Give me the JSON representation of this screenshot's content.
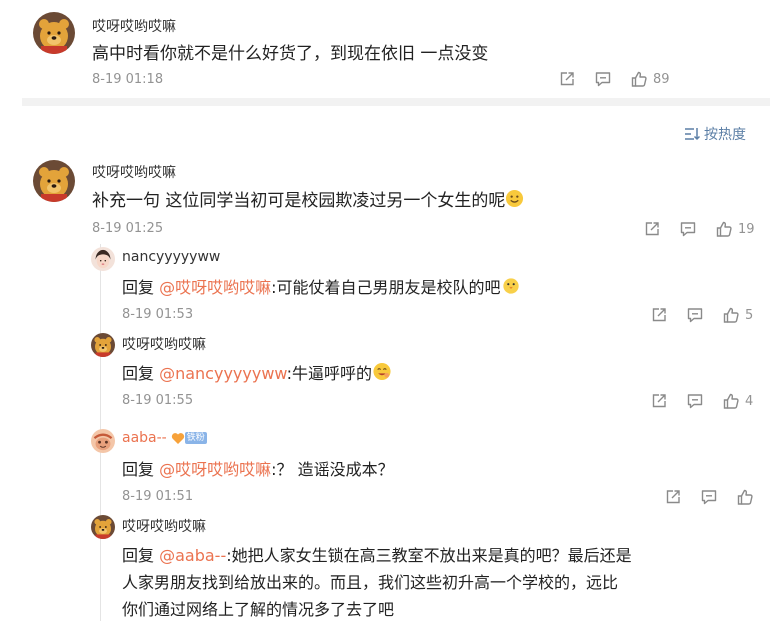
{
  "comments": [
    {
      "user": "哎呀哎哟哎嘛",
      "text": "高中时看你就不是什么好货了，到现在依旧 一点没变",
      "time": "8-19 01:18",
      "likes": "89"
    },
    {
      "user": "哎呀哎哟哎嘛",
      "text": "补充一句 这位同学当初可是校园欺凌过另一个女生的呢",
      "time": "8-19 01:25",
      "likes": "19",
      "replies": [
        {
          "user": "nancyyyyyww",
          "prefix": "回复 ",
          "mention": "@哎呀哎哟哎嘛",
          "text": ":可能仗着自己男朋友是校队的吧",
          "time": "8-19 01:53",
          "likes": "5"
        },
        {
          "user": "哎呀哎哟哎嘛",
          "prefix": "回复 ",
          "mention": "@nancyyyyyww",
          "text": ":牛逼呼呼的",
          "time": "8-19 01:55",
          "likes": "4"
        },
        {
          "user": "aaba--",
          "badge": "铁粉",
          "prefix": "回复 ",
          "mention": "@哎呀哎哟哎嘛",
          "text": ":？ 造谣没成本？",
          "time": "8-19 01:51",
          "likes": ""
        },
        {
          "user": "哎呀哎哟哎嘛",
          "prefix": "回复 ",
          "mention": "@aaba--",
          "text_lines": [
            ":她把人家女生锁在高三教室不放出来是真的吧？最后还是",
            "人家男朋友找到给放出来的。而且，我们这些初升高一个学校的，远比",
            "你们通过网络上了解的情况多了去了吧"
          ]
        }
      ]
    }
  ],
  "sort_label": "按热度",
  "icons": {
    "share": "share-icon",
    "comment": "comment-icon",
    "like": "like-icon",
    "sort": "sort-icon"
  },
  "colors": {
    "mention": "#eb7350",
    "sort": "#5c7fa6",
    "meta": "#939393"
  }
}
